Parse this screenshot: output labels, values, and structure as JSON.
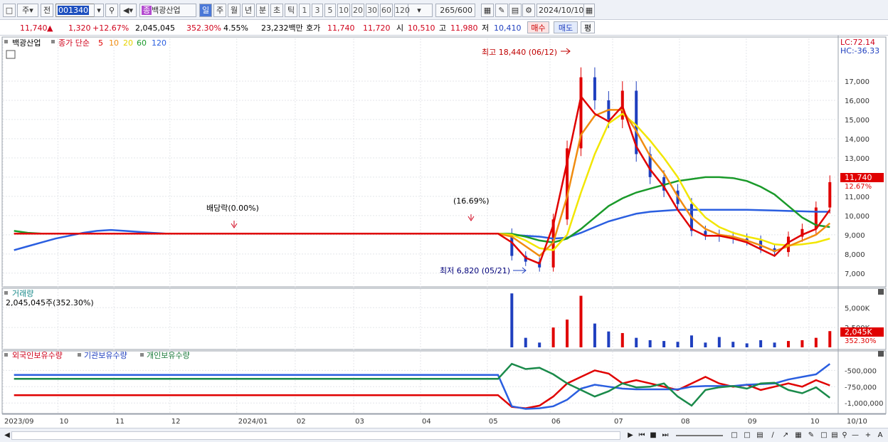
{
  "toolbar": {
    "period_select": "주",
    "prev_label": "전",
    "code": "001340",
    "badge": "종",
    "stock_name": "백광산업",
    "tabs": [
      "일",
      "주",
      "월",
      "년",
      "분",
      "초",
      "틱"
    ],
    "minute_buttons": [
      "1",
      "3",
      "5",
      "10",
      "20",
      "30",
      "60",
      "120"
    ],
    "count": "265",
    "count_total": "/600",
    "date": "2024/10/10"
  },
  "quote": {
    "price": "11,740",
    "arrow": "▲",
    "change": "1,320",
    "change_pct": "+12.67%",
    "volume": "2,045,045",
    "volume_ratio": "352.30%",
    "turnover": "4.55%",
    "amount": "23,232백만",
    "ask_label": "호가",
    "ask1": "11,740",
    "ask2": "11,720",
    "open_label": "시",
    "open": "10,510",
    "high_label": "고",
    "high": "11,980",
    "low_label": "저",
    "low": "10,410",
    "buy_label": "매수",
    "sell_label": "매도",
    "eval_label": "평"
  },
  "price_panel": {
    "name_tag": "백광산업",
    "ma_label": "종가 단순",
    "ma_periods": [
      "5",
      "10",
      "20",
      "60",
      "120"
    ],
    "lc_label": "LC:72.14",
    "hc_label": "HC:-36.33",
    "high_annotation": "최고 18,440 (06/12)",
    "low_annotation": "최저 6,820 (05/21)",
    "dividend_annotation": "배당락(0.00%)",
    "jump_annotation": "(16.69%)",
    "current_price_tag": "11,740",
    "current_pct_tag": "12.67%"
  },
  "volume_panel": {
    "title": "거래량",
    "info": "2,045,045주(352.30%)",
    "current_tag": "2,045K",
    "current_pct": "352.30%"
  },
  "holding_panel": {
    "legend": [
      "외국인보유수량",
      "기관보유수량",
      "개인보유수량"
    ]
  },
  "colors": {
    "ma5": "#e00000",
    "ma10": "#f08c10",
    "ma20": "#f2e600",
    "ma60": "#1a9a2a",
    "ma120": "#2a5ee0",
    "up": "#e00000",
    "down": "#1f3fbf"
  },
  "chart_data": [
    {
      "type": "candlestick",
      "title": "",
      "y_ticks": [
        "17,000",
        "16,000",
        "15,000",
        "14,000",
        "13,000",
        "12,000",
        "11,000",
        "10,000",
        "9,000",
        "8,000",
        "7,000"
      ],
      "ylim": [
        6400,
        19000
      ],
      "x_ticks": [
        "2023/09",
        "10",
        "11",
        "12",
        "2024/01",
        "02",
        "03",
        "04",
        "05",
        "06",
        "07",
        "08",
        "09",
        "10",
        "10/10"
      ],
      "weekly_close": [
        9060,
        9060,
        9060,
        9060,
        9060,
        9060,
        9060,
        9060,
        9060,
        9060,
        9060,
        9060,
        9060,
        9060,
        9060,
        9060,
        9060,
        9060,
        9060,
        9060,
        9060,
        9060,
        9060,
        9060,
        9060,
        9060,
        9060,
        9060,
        9060,
        9060,
        9060,
        9060,
        9060,
        9060,
        9060,
        9060,
        7900,
        7600,
        7300,
        9800,
        13500,
        17200,
        16000,
        15000,
        16500,
        13200,
        12000,
        11300,
        10600,
        9200,
        9000,
        8900,
        8800,
        8700,
        8300,
        8100,
        8900,
        9300,
        10420,
        11740
      ],
      "ma5": [
        9060,
        9060,
        9060,
        9060,
        9060,
        9060,
        9060,
        9060,
        9060,
        9060,
        9060,
        9060,
        9060,
        9060,
        9060,
        9060,
        9060,
        9060,
        9060,
        9060,
        9060,
        9060,
        9060,
        9060,
        9060,
        9060,
        9060,
        9060,
        9060,
        9060,
        9060,
        9060,
        9060,
        9060,
        9060,
        9060,
        8600,
        7800,
        7500,
        9500,
        12800,
        16200,
        15300,
        14900,
        15700,
        13600,
        12400,
        11500,
        10300,
        9300,
        8950,
        8950,
        8800,
        8600,
        8250,
        7900,
        8600,
        9000,
        9300,
        10300
      ],
      "ma10": [
        9060,
        9060,
        9060,
        9060,
        9060,
        9060,
        9060,
        9060,
        9060,
        9060,
        9060,
        9060,
        9060,
        9060,
        9060,
        9060,
        9060,
        9060,
        9060,
        9060,
        9060,
        9060,
        9060,
        9060,
        9060,
        9060,
        9060,
        9060,
        9060,
        9060,
        9060,
        9060,
        9060,
        9060,
        9060,
        9060,
        8900,
        8400,
        7900,
        8600,
        11000,
        14200,
        15200,
        15500,
        15500,
        14400,
        13100,
        12200,
        11000,
        9900,
        9300,
        9000,
        8900,
        8700,
        8450,
        8150,
        8400,
        8700,
        9000,
        9600
      ],
      "ma20": [
        9060,
        9060,
        9060,
        9060,
        9060,
        9060,
        9060,
        9060,
        9060,
        9060,
        9060,
        9060,
        9060,
        9060,
        9060,
        9060,
        9060,
        9060,
        9060,
        9060,
        9060,
        9060,
        9060,
        9060,
        9060,
        9060,
        9060,
        9060,
        9060,
        9060,
        9060,
        9060,
        9060,
        9060,
        9060,
        9060,
        9000,
        8700,
        8300,
        8200,
        9000,
        11200,
        13200,
        14800,
        15300,
        14700,
        13900,
        13000,
        12000,
        10700,
        9900,
        9400,
        9100,
        8900,
        8750,
        8500,
        8450,
        8500,
        8600,
        8800
      ],
      "ma60": [
        9200,
        9100,
        9060,
        9060,
        9060,
        9060,
        9060,
        9060,
        9060,
        9060,
        9060,
        9060,
        9060,
        9060,
        9060,
        9060,
        9060,
        9060,
        9060,
        9060,
        9060,
        9060,
        9060,
        9060,
        9060,
        9060,
        9060,
        9060,
        9060,
        9060,
        9060,
        9060,
        9060,
        9060,
        9060,
        9060,
        9050,
        8900,
        8700,
        8600,
        8800,
        9300,
        9900,
        10500,
        10900,
        11200,
        11400,
        11600,
        11800,
        11900,
        12000,
        12000,
        11950,
        11800,
        11500,
        11100,
        10500,
        9900,
        9500,
        9400
      ],
      "ma120": [
        8200,
        8400,
        8600,
        8800,
        8950,
        9100,
        9200,
        9250,
        9200,
        9150,
        9100,
        9060,
        9060,
        9060,
        9060,
        9060,
        9060,
        9060,
        9060,
        9060,
        9060,
        9060,
        9060,
        9060,
        9060,
        9060,
        9060,
        9060,
        9060,
        9060,
        9060,
        9060,
        9060,
        9060,
        9060,
        9060,
        9000,
        8950,
        8900,
        8800,
        8850,
        9100,
        9400,
        9700,
        9900,
        10100,
        10200,
        10250,
        10300,
        10300,
        10300,
        10300,
        10300,
        10300,
        10280,
        10260,
        10240,
        10220,
        10200,
        10200
      ]
    },
    {
      "type": "bar",
      "title": "거래량",
      "y_ticks": [
        "5,000K",
        "2,500K"
      ],
      "ylim": [
        0,
        7000
      ],
      "volume_k": [
        0,
        0,
        0,
        0,
        0,
        0,
        0,
        0,
        0,
        0,
        0,
        0,
        0,
        0,
        0,
        0,
        0,
        0,
        0,
        0,
        0,
        0,
        0,
        0,
        0,
        0,
        0,
        0,
        0,
        0,
        0,
        0,
        0,
        0,
        0,
        0,
        6800,
        1200,
        600,
        2500,
        3500,
        6500,
        3000,
        2000,
        1800,
        1200,
        900,
        800,
        700,
        1500,
        600,
        1300,
        700,
        500,
        900,
        600,
        800,
        900,
        1200,
        2045
      ]
    },
    {
      "type": "line",
      "title": "",
      "y_ticks": [
        "-500,000",
        "-750,000",
        "-1,000,000"
      ],
      "ylim": [
        -1150000,
        -300000
      ],
      "series": [
        {
          "name": "외국인보유수량",
          "values": [
            -880000,
            -880000,
            -880000,
            -880000,
            -880000,
            -880000,
            -880000,
            -880000,
            -880000,
            -880000,
            -880000,
            -880000,
            -880000,
            -880000,
            -880000,
            -880000,
            -880000,
            -880000,
            -880000,
            -880000,
            -880000,
            -880000,
            -880000,
            -880000,
            -880000,
            -880000,
            -880000,
            -880000,
            -880000,
            -880000,
            -880000,
            -880000,
            -880000,
            -880000,
            -880000,
            -880000,
            -1060000,
            -1080000,
            -1040000,
            -900000,
            -700000,
            -600000,
            -500000,
            -550000,
            -700000,
            -650000,
            -700000,
            -750000,
            -800000,
            -700000,
            -600000,
            -700000,
            -750000,
            -720000,
            -800000,
            -750000,
            -700000,
            -750000,
            -650000,
            -730000
          ]
        },
        {
          "name": "기관보유수량",
          "values": [
            -570000,
            -570000,
            -570000,
            -570000,
            -570000,
            -570000,
            -570000,
            -570000,
            -570000,
            -570000,
            -570000,
            -570000,
            -570000,
            -570000,
            -570000,
            -570000,
            -570000,
            -570000,
            -570000,
            -570000,
            -570000,
            -570000,
            -570000,
            -570000,
            -570000,
            -570000,
            -570000,
            -570000,
            -570000,
            -570000,
            -570000,
            -570000,
            -570000,
            -570000,
            -570000,
            -570000,
            -1050000,
            -1090000,
            -1080000,
            -1050000,
            -950000,
            -780000,
            -720000,
            -750000,
            -780000,
            -790000,
            -790000,
            -790000,
            -790000,
            -750000,
            -740000,
            -740000,
            -740000,
            -720000,
            -710000,
            -700000,
            -640000,
            -600000,
            -560000,
            -400000
          ]
        },
        {
          "name": "개인보유수량",
          "values": [
            -630000,
            -630000,
            -630000,
            -630000,
            -630000,
            -630000,
            -630000,
            -630000,
            -630000,
            -630000,
            -630000,
            -630000,
            -630000,
            -630000,
            -630000,
            -630000,
            -630000,
            -630000,
            -630000,
            -630000,
            -630000,
            -630000,
            -630000,
            -630000,
            -630000,
            -630000,
            -630000,
            -630000,
            -630000,
            -630000,
            -630000,
            -630000,
            -630000,
            -630000,
            -630000,
            -630000,
            -400000,
            -480000,
            -460000,
            -560000,
            -700000,
            -800000,
            -900000,
            -820000,
            -700000,
            -760000,
            -750000,
            -700000,
            -900000,
            -1040000,
            -800000,
            -760000,
            -740000,
            -780000,
            -700000,
            -690000,
            -800000,
            -850000,
            -760000,
            -920000
          ]
        }
      ]
    }
  ]
}
